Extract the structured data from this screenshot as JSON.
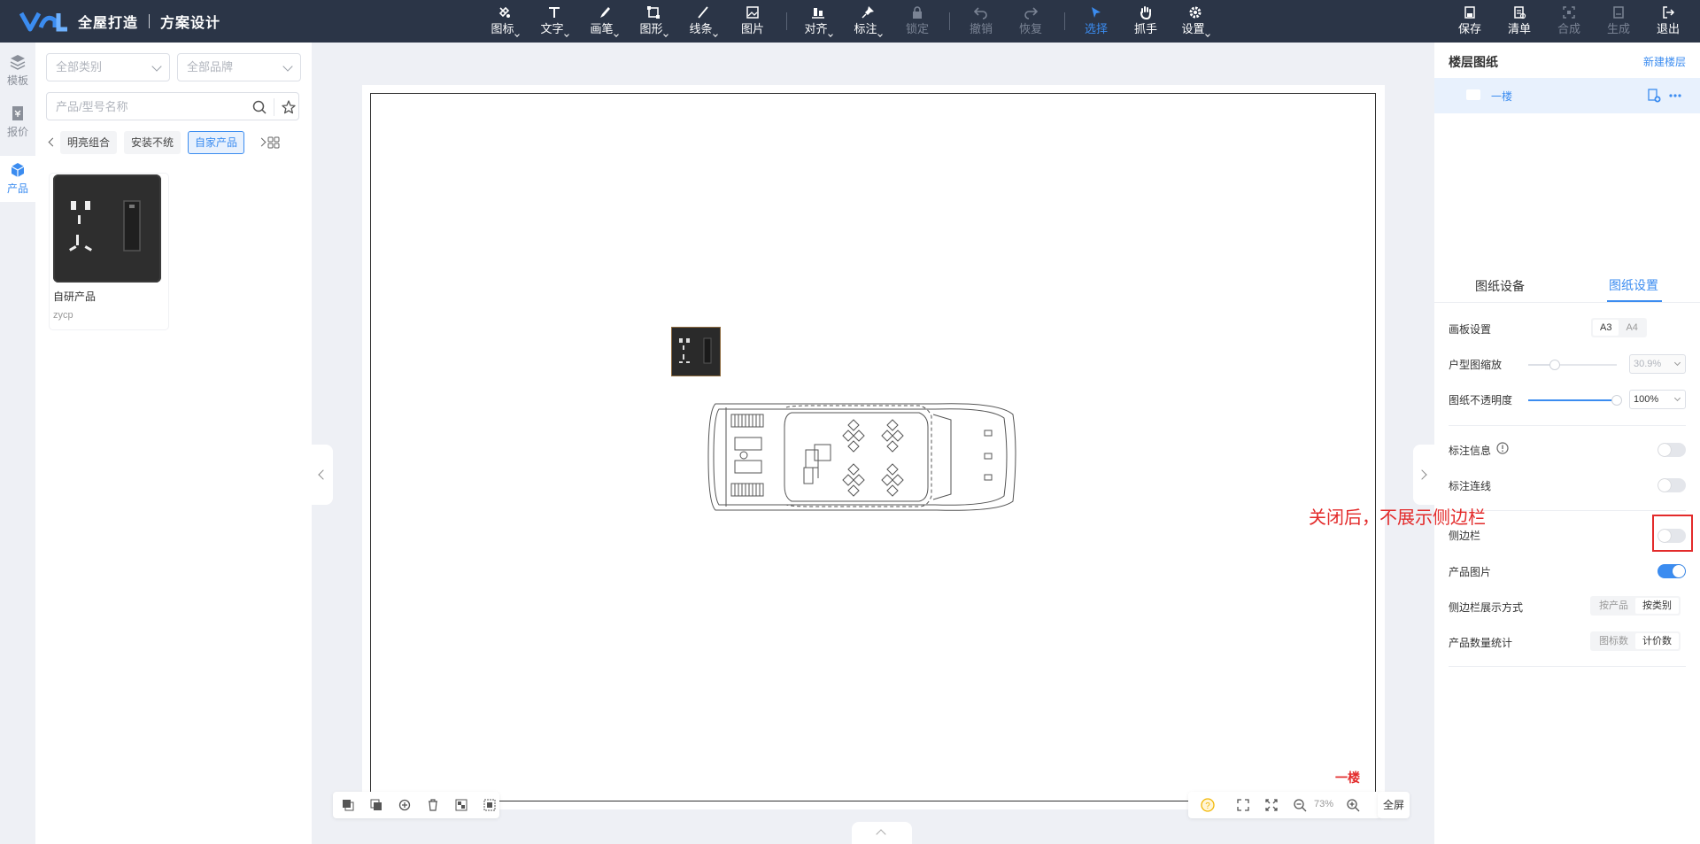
{
  "brand": {
    "name": "全屋打造",
    "sub": "方案设计"
  },
  "toolbar": {
    "tools": [
      {
        "id": "icon",
        "label": "图标"
      },
      {
        "id": "text",
        "label": "文字"
      },
      {
        "id": "brush",
        "label": "画笔"
      },
      {
        "id": "shape",
        "label": "图形"
      },
      {
        "id": "line",
        "label": "线条"
      },
      {
        "id": "image",
        "label": "图片"
      },
      {
        "id": "align",
        "label": "对齐"
      },
      {
        "id": "mark",
        "label": "标注"
      },
      {
        "id": "lock",
        "label": "锁定"
      },
      {
        "id": "undo",
        "label": "撤销"
      },
      {
        "id": "redo",
        "label": "恢复"
      },
      {
        "id": "select",
        "label": "选择"
      },
      {
        "id": "hand",
        "label": "抓手"
      },
      {
        "id": "settings",
        "label": "设置"
      }
    ],
    "actions": [
      {
        "id": "save",
        "label": "保存"
      },
      {
        "id": "list",
        "label": "清单"
      },
      {
        "id": "compose",
        "label": "合成"
      },
      {
        "id": "generate",
        "label": "生成"
      },
      {
        "id": "exit",
        "label": "退出"
      }
    ]
  },
  "rail": [
    {
      "label": "模板",
      "icon": "layers-icon"
    },
    {
      "label": "报价",
      "icon": "quote-icon"
    },
    {
      "label": "产品",
      "icon": "cube-icon"
    }
  ],
  "filters": {
    "category_placeholder": "全部类别",
    "brand_placeholder": "全部品牌",
    "search_placeholder": "产品/型号名称"
  },
  "tabs": [
    "明亮组合",
    "安装不统",
    "自家产品"
  ],
  "products": [
    {
      "name": "自研产品",
      "code": "zycp"
    }
  ],
  "canvas": {
    "floor_label": "一楼",
    "zoom": "73%",
    "fullscreen": "全屏"
  },
  "right_panel": {
    "title": "楼层图纸",
    "new_floor": "新建楼层",
    "floors": [
      "一楼"
    ],
    "tabs": [
      "图纸设备",
      "图纸设置"
    ],
    "settings": {
      "board_label": "画板设置",
      "board_options": [
        "A3",
        "A4"
      ],
      "board_selected": "A3",
      "scale_label": "户型图缩放",
      "scale_value": "30.9%",
      "scale_level": 0.3,
      "opacity_label": "图纸不透明度",
      "opacity_value": "100%",
      "opacity_level": 1.0,
      "mark_info_label": "标注信息",
      "mark_info_on": false,
      "mark_line_label": "标注连线",
      "mark_line_on": false,
      "sidebar_label": "侧边栏",
      "sidebar_on": false,
      "product_image_label": "产品图片",
      "product_image_on": true,
      "sidebar_mode_label": "侧边栏展示方式",
      "sidebar_mode_options": [
        "按产品",
        "按类别"
      ],
      "sidebar_mode_selected": "按类别",
      "count_label": "产品数量统计",
      "count_options": [
        "图标数",
        "计价数"
      ],
      "count_selected": "计价数"
    }
  },
  "annotation": "关闭后，不展示侧边栏",
  "colors": {
    "topbar": "#2b3547",
    "accent": "#3b8cf0",
    "annotation": "#e32b2b"
  }
}
